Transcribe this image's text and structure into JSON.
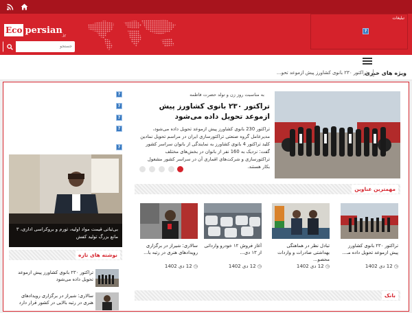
{
  "topbar": {
    "icons": [
      "rss-icon",
      "home-icon"
    ]
  },
  "header": {
    "logo": {
      "eco": "Eco",
      "persian": "persian",
      "tld": ".ir"
    },
    "search": {
      "placeholder": "جستجو"
    },
    "ad_label": "تبلیغات"
  },
  "ticker": {
    "label": "ویژه های خبری",
    "text": "تراکتور ۲۳۰ بانوی کشاورز پیش ازموعد تحو..."
  },
  "headline": {
    "kicker": "به مناسبت روز زن و تولد حضرت فاطمه",
    "title": "تراکتور ۲۳۰ بانوی کشاورز پیش ازموعد تحویل داده می‌شود",
    "summary": "تراکتور 230 بانوی کشاورز پیش ازموعد تحویل داده می‌شود، مدیرعامل گروه صنعتی تراکتورسازی ایران در مراسم تحویل نمادین کلید تراکتور 4 بانوی کشاورز به نمایندگی از بانوان سراسر کشور گفت: نزدیک به 160 نفر از بانوان در بخش‌های مختلف تراکتورسازی و شرکت‌های اقماری آن در سراسر کشور مشغول بکار هستند.",
    "slides": 5,
    "active_slide": 1
  },
  "left_feature": {
    "caption": "بی‌ثباتی قیمت مواد اولیه، تورم و بروکراسی اداری، ۳ مانع بزرگ تولید کفش"
  },
  "newest": {
    "label": "نوشته های تازه",
    "items": [
      {
        "title": "تراکتور ۲۳۰ بانوی کشاورز پیش ازموعد تحویل داده می‌شود"
      },
      {
        "title": "سالاری: شیراز در برگزاری رویدادهای هنری در رتبه بالایی در کشور قرار دارد"
      }
    ]
  },
  "important": {
    "label": "مهمترین عناوین",
    "cards": [
      {
        "title": "تراکتور ۲۳۰ بانوی کشاورز پیش ازموعد تحویل داده مـ...",
        "date": "12 دی 1402"
      },
      {
        "title": "تبادل نظر در هماهنگی بهداشتی صادرات و واردات محصو...",
        "date": "12 دی 1402"
      },
      {
        "title": "آغاز فروش ۱۲ خودرو وارداتی از ۱۳ دی...",
        "date": "12 دی 1402"
      },
      {
        "title": "سالاری: شیراز در برگزاری رویدادهای هنری در رتبه با...",
        "date": "12 دی 1402"
      }
    ]
  },
  "bank": {
    "label": "بانک"
  }
}
